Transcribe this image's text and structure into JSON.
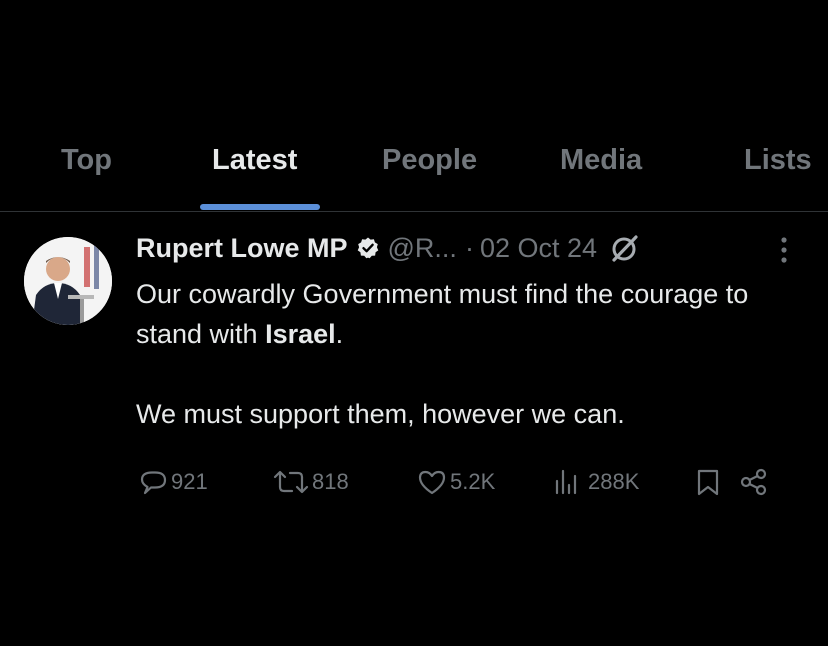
{
  "tabs": [
    {
      "label": "Top",
      "active": false
    },
    {
      "label": "Latest",
      "active": true
    },
    {
      "label": "People",
      "active": false
    },
    {
      "label": "Media",
      "active": false
    },
    {
      "label": "Lists",
      "active": false
    }
  ],
  "tweet": {
    "author_name": "Rupert Lowe MP",
    "handle": "@R...",
    "separator": "·",
    "date": "02 Oct 24",
    "text_line1_pre": "Our cowardly Government must find the courage to stand with ",
    "text_line1_bold": "Israel",
    "text_line1_post": ".",
    "text_para2": "We must support them, however we can.",
    "replies": "921",
    "reposts": "818",
    "likes": "5.2K",
    "views": "288K"
  },
  "icons": {
    "verified": "verified-badge-icon",
    "grok": "grok-icon",
    "more": "more-vertical-icon",
    "reply": "reply-icon",
    "repost": "repost-icon",
    "like": "heart-icon",
    "views": "views-icon",
    "bookmark": "bookmark-icon",
    "share": "share-icon"
  },
  "colors": {
    "background": "#000000",
    "primary_text": "#e7e9ea",
    "secondary_text": "#71767b",
    "tab_indicator": "#5b8fd8",
    "divider": "#2f3336"
  }
}
